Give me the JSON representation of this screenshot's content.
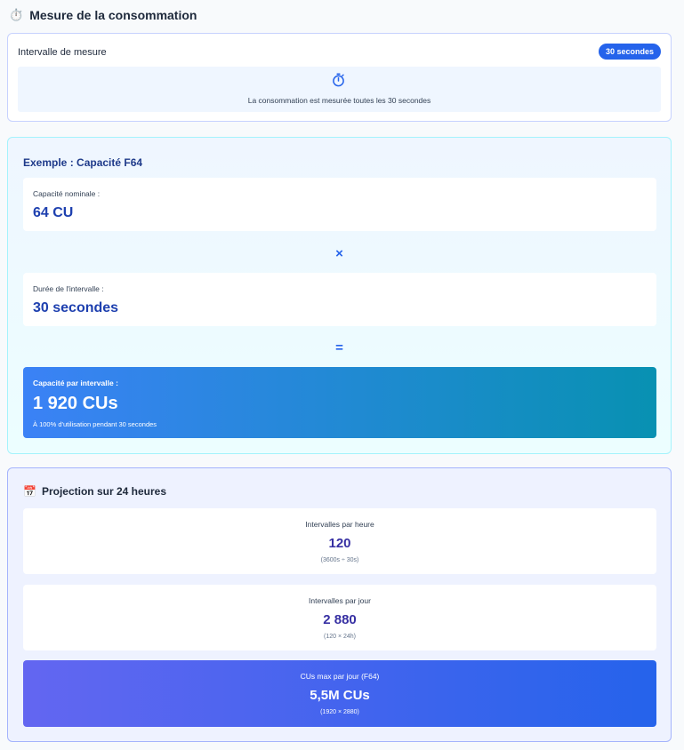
{
  "header": {
    "icon": "stopwatch-icon",
    "emoji": "⏱️",
    "title": "Mesure de la consommation"
  },
  "interval": {
    "label": "Intervalle de mesure",
    "badge": "30 secondes",
    "icon": "timer-icon",
    "description": "La consommation est mesurée toutes les 30 secondes"
  },
  "example": {
    "title": "Exemple : Capacité F64",
    "nominal_label": "Capacité nominale :",
    "nominal_value": "64 CU",
    "multiply_symbol": "×",
    "duration_label": "Durée de l'intervalle :",
    "duration_value": "30 secondes",
    "equals_symbol": "=",
    "result_label": "Capacité par intervalle :",
    "result_value": "1 920 CUs",
    "result_note": "À 100% d'utilisation pendant 30 secondes"
  },
  "projection": {
    "icon": "calendar-icon",
    "emoji": "📅",
    "title": "Projection sur 24 heures",
    "per_hour_label": "Intervalles par heure",
    "per_hour_value": "120",
    "per_hour_formula": "(3600s ÷ 30s)",
    "per_day_label": "Intervalles par jour",
    "per_day_value": "2 880",
    "per_day_formula": "(120 × 24h)",
    "max_label": "CUs max par jour (F64)",
    "max_value": "5,5M CUs",
    "max_formula": "(1920 × 2880)"
  },
  "colors": {
    "accent": "#2563eb",
    "cyan": "#0891b2",
    "indigo": "#6366f1",
    "value_text": "#1e40af"
  }
}
